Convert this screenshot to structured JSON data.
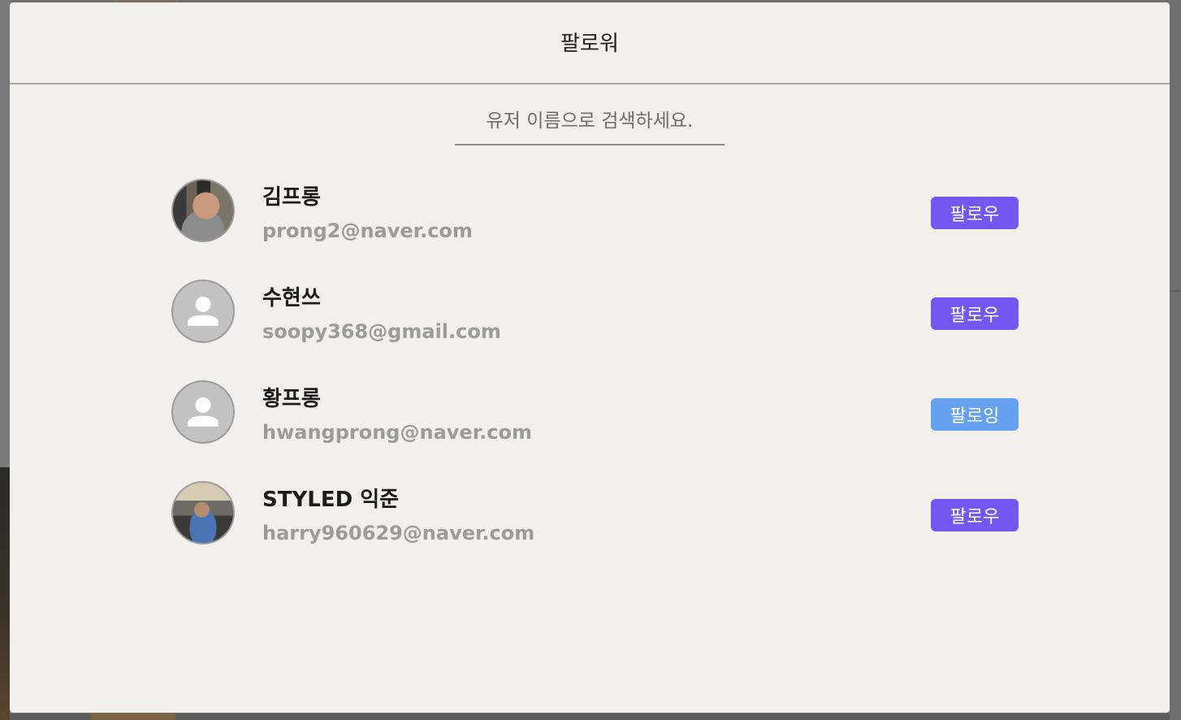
{
  "modal": {
    "title": "팔로워"
  },
  "search": {
    "placeholder": "유저 이름으로 검색하세요."
  },
  "users": [
    {
      "name": "김프롱",
      "email": "prong2@naver.com",
      "button": "팔로우",
      "avatar": "photo"
    },
    {
      "name": "수현쓰",
      "email": "soopy368@gmail.com",
      "button": "팔로우",
      "avatar": "default-person-icon"
    },
    {
      "name": "황프롱",
      "email": "hwangprong@naver.com",
      "button": "팔로잉",
      "avatar": "default-person-icon"
    },
    {
      "name": "STYLED 익준",
      "email": "harry960629@naver.com",
      "button": "팔로우",
      "avatar": "photo"
    }
  ],
  "colors": {
    "follow_button": "#7257f0",
    "following_button": "#66a1ef",
    "modal_background": "#f1f0ed",
    "email_text": "#9b9b9b"
  }
}
